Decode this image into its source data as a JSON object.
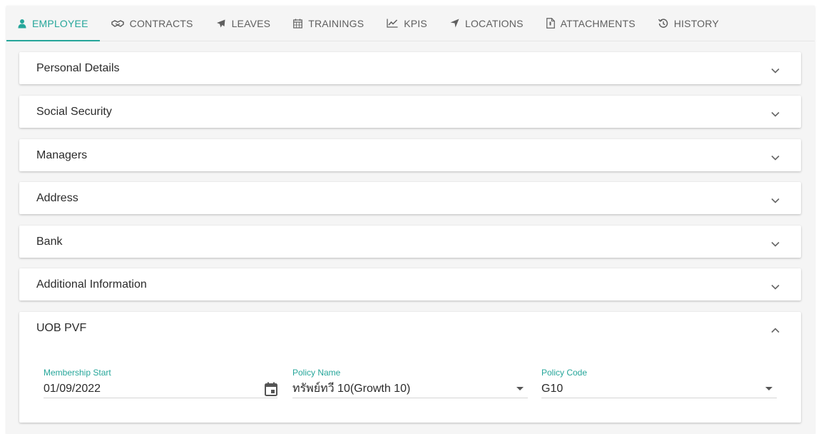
{
  "tabs": [
    {
      "label": "EMPLOYEE",
      "icon": "person-icon",
      "active": true
    },
    {
      "label": "CONTRACTS",
      "icon": "handshake-icon"
    },
    {
      "label": "LEAVES",
      "icon": "airplane-icon"
    },
    {
      "label": "TRAININGS",
      "icon": "calendar-icon"
    },
    {
      "label": "KPIS",
      "icon": "line-chart-icon"
    },
    {
      "label": "LOCATIONS",
      "icon": "location-arrow-icon"
    },
    {
      "label": "ATTACHMENTS",
      "icon": "file-icon"
    },
    {
      "label": "HISTORY",
      "icon": "history-icon"
    }
  ],
  "sections": [
    {
      "title": "Personal Details",
      "expanded": false
    },
    {
      "title": "Social Security",
      "expanded": false
    },
    {
      "title": "Managers",
      "expanded": false
    },
    {
      "title": "Address",
      "expanded": false
    },
    {
      "title": "Bank",
      "expanded": false
    },
    {
      "title": "Additional Information",
      "expanded": false
    },
    {
      "title": "UOB PVF",
      "expanded": true
    }
  ],
  "uob_pvf": {
    "membership_start": {
      "label": "Membership Start",
      "value": "01/09/2022"
    },
    "policy_name": {
      "label": "Policy Name",
      "value": "ทรัพย์ทวี 10(Growth 10)"
    },
    "policy_code": {
      "label": "Policy Code",
      "value": "G10"
    }
  },
  "colors": {
    "accent": "#26a69a",
    "text": "#2b2b2b",
    "muted": "#5f5f5f"
  }
}
